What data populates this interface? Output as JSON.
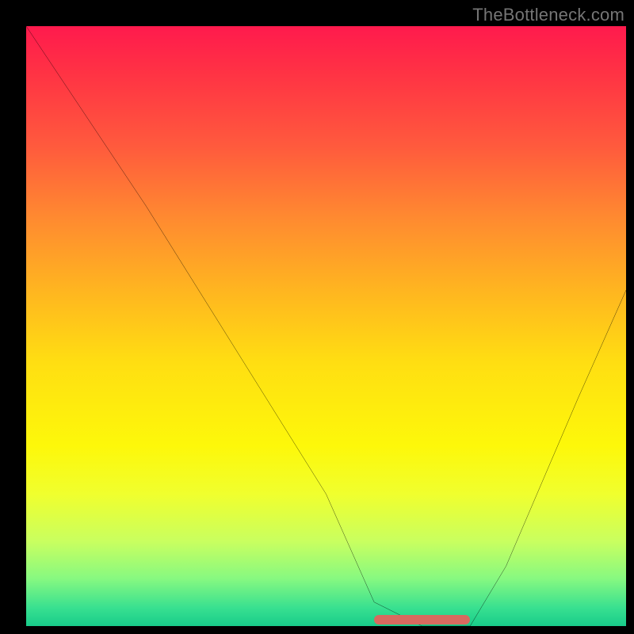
{
  "watermark": "TheBottleneck.com",
  "bump": {
    "left_pct": 58,
    "width_pct": 16
  },
  "chart_data": {
    "type": "line",
    "title": "",
    "xlabel": "",
    "ylabel": "",
    "xlim": [
      0,
      100
    ],
    "ylim": [
      0,
      100
    ],
    "grid": false,
    "legend": false,
    "annotations": [],
    "series": [
      {
        "name": "curve",
        "x": [
          0,
          10,
          20,
          30,
          40,
          50,
          58,
          66,
          74,
          80,
          86,
          92,
          100
        ],
        "values": [
          100,
          85,
          70,
          54,
          38,
          22,
          4,
          0,
          0,
          10,
          24,
          38,
          56
        ]
      }
    ],
    "background_gradient": {
      "top": "#ff1a4d",
      "mid": "#ffde12",
      "bottom": "#18cc8a"
    },
    "bump_segment": {
      "x_start": 58,
      "x_end": 74,
      "y": 0,
      "color": "#d86a5f"
    }
  }
}
